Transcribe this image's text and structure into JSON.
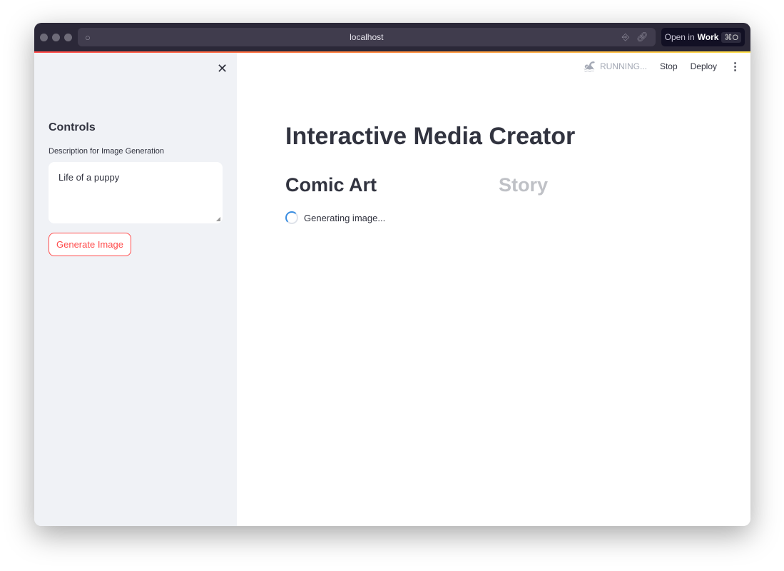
{
  "browser": {
    "url": "localhost",
    "open_in": "Open in",
    "open_target": "Work",
    "shortcut": "⌘O"
  },
  "sidebar": {
    "title": "Controls",
    "field_label": "Description for Image Generation",
    "field_value": "Life of a puppy",
    "button": "Generate Image"
  },
  "toolbar": {
    "status": "RUNNING...",
    "stop": "Stop",
    "deploy": "Deploy"
  },
  "main": {
    "title": "Interactive Media Creator",
    "tabs": [
      {
        "label": "Comic Art"
      },
      {
        "label": "Story"
      }
    ],
    "spinner_text": "Generating image..."
  }
}
